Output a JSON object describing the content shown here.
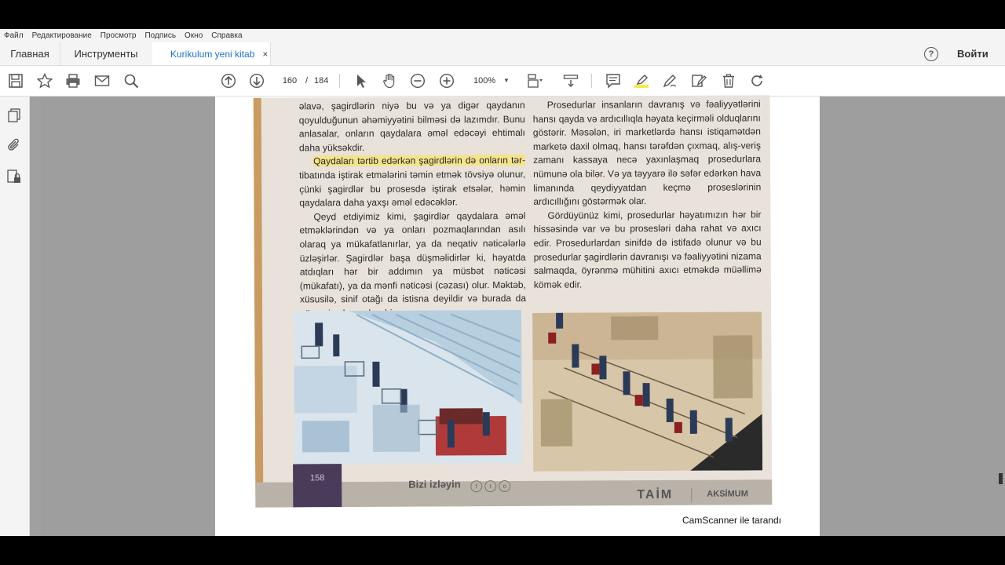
{
  "menu": [
    "Файл",
    "Редактирование",
    "Просмотр",
    "Подпись",
    "Окно",
    "Справка"
  ],
  "tabs": {
    "home": "Главная",
    "tools": "Инструменты",
    "document": "Kurikulum yeni kitab",
    "close": "×"
  },
  "header": {
    "help": "?",
    "signin": "Войти"
  },
  "toolbar": {
    "page_current": "160",
    "page_separator": "/",
    "page_total": "184",
    "zoom": "100%"
  },
  "page": {
    "left_column": {
      "p1": "əlavə, şagirdlərin niyə bu və ya digər qaydanın qoyulduğunun əhəmiyyətini bilməsi də lazımdır. Bunu anlasalar, onların qaydalara əməl edəcəyi ehtimalı daha yüksəkdir.",
      "p2_highlight": "Qaydaları tərtib edərkən şagirdlərin də onların tər-",
      "p2_rest": "tibatında iştirak etmələrini təmin etmək tövsiyə olunur, çünki şagirdlər bu prosesdə iştirak etsələr, həmin qaydalara daha yaxşı əməl edəcəklər.",
      "p3": "Qeyd etdiyimiz kimi, şagirdlər qaydalara əməl etməklərindən və ya onları pozmaqlarından asılı olaraq ya mükafatlanırlar, ya da neqativ nəticələrlə üzləşirlər. Şagirdlər başa düşməlidirlər ki, həyatda atdıqları hər bir addımın ya müsbət nəticəsi (mükafatı), ya da mənfi nəticəsi (cəzası) olur. Məktəb, xüsusilə, sinif otağı da istisna deyildir və burada da nümayiş olunan hər bir"
    },
    "right_column": {
      "p1": "Prosedurlar insanların davranış və fəaliyyətlərini hansı qayda və ardıcıllıqla həyata keçirməli olduqlarını göstərir. Məsələn, iri marketlərdə hansı istiqamətdən marketə daxil olmaq, hansı tərəfdən çıxmaq, alış-veriş zamanı kassaya necə yaxınlaşmaq prosedurlara nümunə ola bilər. Və ya təyyarə ilə səfər edərkən hava limanında qeydiyyatdan keçmə proseslərinin ardıcıllığını göstərmək olar.",
      "p2": "Gördüyünüz kimi, prosedurlar həyatımızın hər bir hissəsində var və bu prosesləri daha rahat və axıcı edir. Prosedurlardan sinifdə də istifadə olunur və bu prosedurlar şagirdlərin davranışı və fəaliyyətini nizama salmaqda, öyrənmə mühitini axıcı etməkdə müəllimə kömək edir."
    },
    "page_number": "158",
    "follow_text": "Bizi izləyin",
    "social_icons": [
      "f",
      "t",
      "o"
    ],
    "brand1": "TAİM",
    "brand2": "AKSİMUM",
    "watermark": "CamScanner ile tarandı"
  },
  "colors": {
    "highlight": "#f4e38b",
    "tab_active_text": "#1a73c9",
    "viewer_background": "#9e9e9e"
  }
}
